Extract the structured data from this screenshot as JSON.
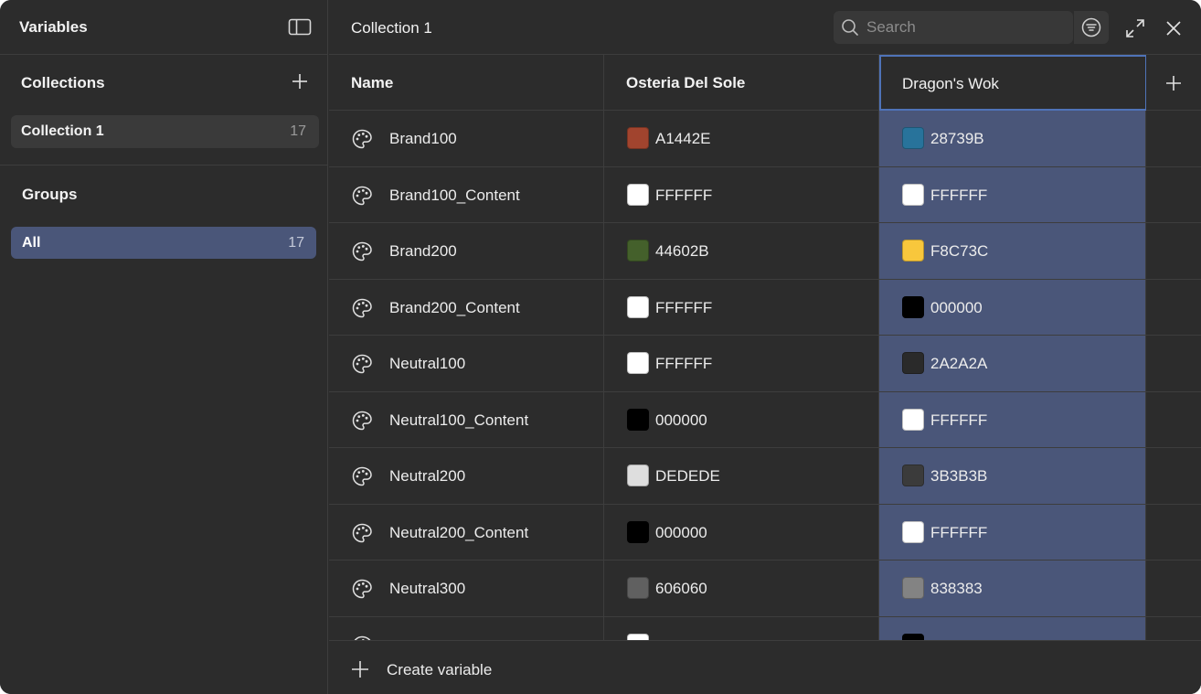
{
  "sidebar": {
    "title": "Variables",
    "collections_title": "Collections",
    "collection": {
      "label": "Collection 1",
      "count": "17"
    },
    "groups_title": "Groups",
    "group": {
      "label": "All",
      "count": "17"
    }
  },
  "header": {
    "title": "Collection 1",
    "search_placeholder": "Search"
  },
  "table": {
    "columns": {
      "name": "Name",
      "mode1": "Osteria Del Sole",
      "mode2": "Dragon's Wok"
    },
    "rows": [
      {
        "name": "Brand100",
        "m1": "A1442E",
        "m1_color": "#A1442E",
        "m2": "28739B",
        "m2_color": "#28739B"
      },
      {
        "name": "Brand100_Content",
        "m1": "FFFFFF",
        "m1_color": "#FFFFFF",
        "m2": "FFFFFF",
        "m2_color": "#FFFFFF"
      },
      {
        "name": "Brand200",
        "m1": "44602B",
        "m1_color": "#44602B",
        "m2": "F8C73C",
        "m2_color": "#F8C73C"
      },
      {
        "name": "Brand200_Content",
        "m1": "FFFFFF",
        "m1_color": "#FFFFFF",
        "m2": "000000",
        "m2_color": "#000000"
      },
      {
        "name": "Neutral100",
        "m1": "FFFFFF",
        "m1_color": "#FFFFFF",
        "m2": "2A2A2A",
        "m2_color": "#2A2A2A"
      },
      {
        "name": "Neutral100_Content",
        "m1": "000000",
        "m1_color": "#000000",
        "m2": "FFFFFF",
        "m2_color": "#FFFFFF"
      },
      {
        "name": "Neutral200",
        "m1": "DEDEDE",
        "m1_color": "#DEDEDE",
        "m2": "3B3B3B",
        "m2_color": "#3B3B3B"
      },
      {
        "name": "Neutral200_Content",
        "m1": "000000",
        "m1_color": "#000000",
        "m2": "FFFFFF",
        "m2_color": "#FFFFFF"
      },
      {
        "name": "Neutral300",
        "m1": "606060",
        "m1_color": "#606060",
        "m2": "838383",
        "m2_color": "#838383"
      },
      {
        "name": "",
        "m1": "",
        "m1_color": "#FFFFFF",
        "m2": "",
        "m2_color": "#000000"
      }
    ]
  },
  "footer": {
    "create_label": "Create variable"
  },
  "colors": {
    "accent": "#4F73B8",
    "selected_fill": "#4A5679",
    "background": "#2C2C2C",
    "border": "#3D3D3D"
  }
}
